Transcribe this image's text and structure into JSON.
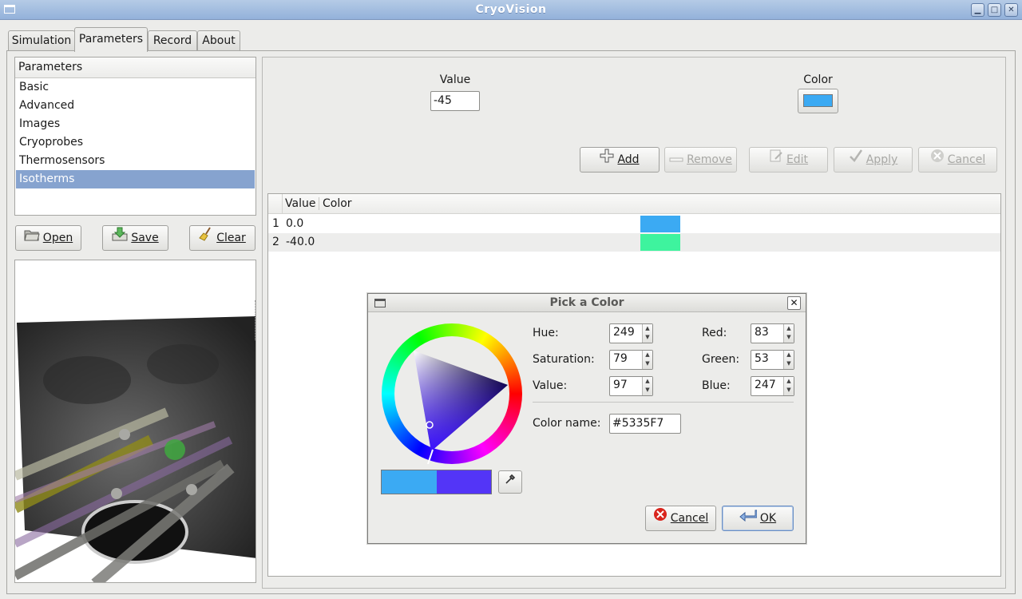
{
  "window": {
    "title": "CryoVision"
  },
  "tabs": [
    {
      "label": "Simulation"
    },
    {
      "label": "Parameters"
    },
    {
      "label": "Record"
    },
    {
      "label": "About"
    }
  ],
  "params_list": {
    "header": "Parameters",
    "items": [
      "Basic",
      "Advanced",
      "Images",
      "Cryoprobes",
      "Thermosensors",
      "Isotherms"
    ],
    "selected": "Isotherms"
  },
  "file_buttons": {
    "open": "Open",
    "save": "Save",
    "clear": "Clear"
  },
  "editor": {
    "value_label": "Value",
    "value": "-45",
    "color_label": "Color",
    "color": "#3baaf3"
  },
  "actions": {
    "add": "Add",
    "remove": "Remove",
    "edit": "Edit",
    "apply": "Apply",
    "cancel": "Cancel"
  },
  "table": {
    "columns": [
      "Value",
      "Color"
    ],
    "rows": [
      {
        "index": "1",
        "value": "0.0",
        "color": "#3baaf3"
      },
      {
        "index": "2",
        "value": "-40.0",
        "color": "#3ef39e"
      }
    ]
  },
  "dialog": {
    "title": "Pick a Color",
    "hue_label": "Hue:",
    "hue": "249",
    "saturation_label": "Saturation:",
    "saturation": "79",
    "value_label": "Value:",
    "value": "97",
    "red_label": "Red:",
    "red": "83",
    "green_label": "Green:",
    "green": "53",
    "blue_label": "Blue:",
    "blue": "247",
    "color_name_label": "Color name:",
    "color_name": "#5335F7",
    "previous_color": "#3baaf3",
    "current_color": "#5335f7",
    "cancel": "Cancel",
    "ok": "OK"
  }
}
